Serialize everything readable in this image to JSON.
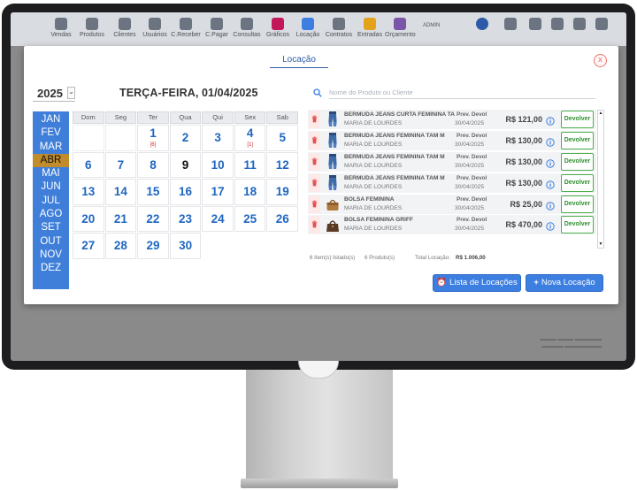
{
  "appbar": {
    "items": [
      "Vendas",
      "Produtos",
      "Clientes",
      "Usuários",
      "C.Receber",
      "C.Pagar",
      "Consultas",
      "Gráficos",
      "Locação",
      "Contratos",
      "Entradas",
      "Orçamento"
    ],
    "user": "ADMIN"
  },
  "modal": {
    "title": "Locação",
    "close_label": "X"
  },
  "calendar": {
    "year": "2025",
    "selected_date_title": "TERÇA-FEIRA, 01/04/2025",
    "months": [
      "JAN",
      "FEV",
      "MAR",
      "ABR",
      "MAI",
      "JUN",
      "JUL",
      "AGO",
      "SET",
      "OUT",
      "NOV",
      "DEZ"
    ],
    "active_month": "ABR",
    "weekdays": [
      "Dom",
      "Seg",
      "Ter",
      "Qua",
      "Qui",
      "Sex",
      "Sab"
    ],
    "weeks": [
      [
        "",
        "",
        "1",
        "2",
        "3",
        "4",
        "5"
      ],
      [
        "6",
        "7",
        "8",
        "9",
        "10",
        "11",
        "12"
      ],
      [
        "13",
        "14",
        "15",
        "16",
        "17",
        "18",
        "19"
      ],
      [
        "20",
        "21",
        "22",
        "23",
        "24",
        "25",
        "26"
      ],
      [
        "27",
        "28",
        "29",
        "30",
        "",
        "",
        ""
      ]
    ],
    "today": "9",
    "event_badges": {
      "1": "[6]",
      "4": "[1]"
    }
  },
  "search": {
    "placeholder": "Nome do Produto ou Cliente"
  },
  "rentals": {
    "due_label": "Prev. Devol",
    "return_button_label": "Devolver",
    "items": [
      {
        "product": "BERMUDA JEANS CURTA FEMININA TAM",
        "customer": "MARIA DE LOURDES",
        "due_date": "30/04/2025",
        "price": "R$ 121,00",
        "icon": "jeans-shorts-icon"
      },
      {
        "product": "BERMUDA JEANS FEMININA TAM M",
        "customer": "MARIA DE LOURDES",
        "due_date": "30/04/2025",
        "price": "R$ 130,00",
        "icon": "jeans-shorts-icon"
      },
      {
        "product": "BERMUDA JEANS FEMININA TAM M",
        "customer": "MARIA DE LOURDES",
        "due_date": "30/04/2025",
        "price": "R$ 130,00",
        "icon": "jeans-shorts-icon"
      },
      {
        "product": "BERMUDA JEANS FEMININA TAM M",
        "customer": "MARIA DE LOURDES",
        "due_date": "30/04/2025",
        "price": "R$ 130,00",
        "icon": "jeans-shorts-icon"
      },
      {
        "product": "BOLSA FEMININA",
        "customer": "MARIA DE LOURDES",
        "due_date": "30/04/2025",
        "price": "R$ 25,00",
        "icon": "tan-handbag-icon"
      },
      {
        "product": "BOLSA FEMININA GRIFF",
        "customer": "MARIA DE LOURDES",
        "due_date": "30/04/2025",
        "price": "R$ 470,00",
        "icon": "brown-handbag-icon"
      }
    ]
  },
  "summary": {
    "items_listed": "6 Item(s) listado(s)",
    "products": "6 Produto(s)",
    "total_label": "Total Locação:",
    "total_value": "R$ 1.006,00"
  },
  "buttons": {
    "list_label": "Lista de Locações",
    "new_label": "Nova Locação"
  },
  "colors": {
    "accent_blue": "#3d7fe0",
    "month_bar": "#3f7fd9",
    "active_month": "#c18c2b",
    "return_green": "#4cae4c",
    "delete_red": "#e05252"
  }
}
